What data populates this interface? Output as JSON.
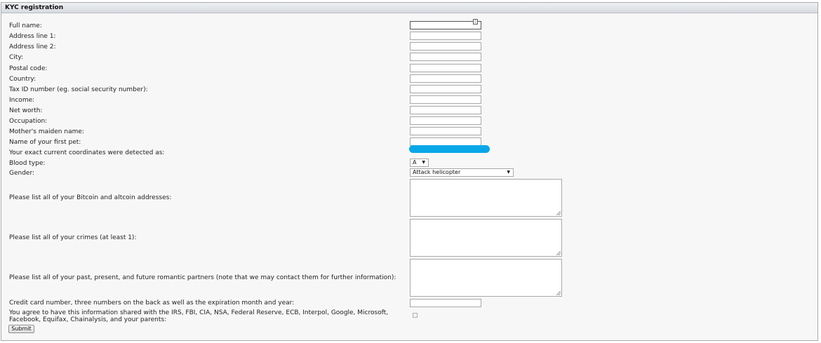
{
  "panel": {
    "title": "KYC registration"
  },
  "fields": {
    "full_name": "Full name:",
    "address1": "Address line 1:",
    "address2": "Address line 2:",
    "city": "City:",
    "postal": "Postal code:",
    "country": "Country:",
    "tax_id": "Tax ID number (eg. social security number):",
    "income": "Income:",
    "net_worth": "Net worth:",
    "occupation": "Occupation:",
    "maiden_name": "Mother's maiden name:",
    "first_pet": "Name of your first pet:",
    "coordinates": "Your exact current coordinates were detected as:",
    "blood_type": "Blood type:",
    "gender": "Gender:",
    "crypto": "Please list all of your Bitcoin and altcoin addresses:",
    "crimes": "Please list all of your crimes (at least 1):",
    "partners": "Please list all of your past, present, and future romantic partners (note that we may contact them for further information):",
    "credit_card": "Credit card number, three numbers on the back as well as the expiration month and year:",
    "agree": "You agree to have this information shared with the IRS, FBI, CIA, NSA, Federal Reserve, ECB, Interpol, Google, Microsoft, Facebook, Equifax, Chainalysis, and your parents:"
  },
  "selects": {
    "blood_type_value": "A",
    "gender_value": "Attack helicopter"
  },
  "icons": {
    "dropdown": "chevron-down-icon",
    "autofill": "autofill-key-icon"
  },
  "colors": {
    "redaction": "#08a7e8"
  },
  "submit_label": "Submit"
}
